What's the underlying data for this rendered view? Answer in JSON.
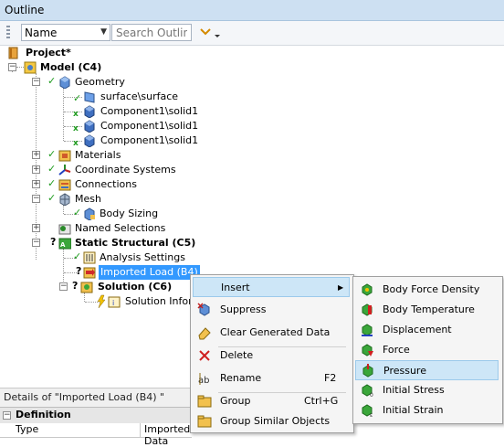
{
  "window": {
    "title": "Outline"
  },
  "toolbar": {
    "filter_value": "Name",
    "search_placeholder": "Search Outline"
  },
  "tree": {
    "project": "Project*",
    "model": "Model (C4)",
    "geometry": "Geometry",
    "geometry_children": [
      "surface\\surface",
      "Component1\\solid1",
      "Component1\\solid1",
      "Component1\\solid1"
    ],
    "materials": "Materials",
    "coordinate_systems": "Coordinate Systems",
    "connections": "Connections",
    "mesh": "Mesh",
    "body_sizing": "Body Sizing",
    "named_selections": "Named Selections",
    "static_structural": "Static Structural (C5)",
    "analysis_settings": "Analysis Settings",
    "imported_load": "Imported Load (B4)",
    "solution": "Solution (C6)",
    "solution_information": "Solution Inform",
    "check_mark": "✓",
    "question_mark": "?"
  },
  "details": {
    "title": "Details of \"Imported Load (B4) \"",
    "group": "Definition",
    "row_key": "Type",
    "row_value": "Imported Data"
  },
  "context_menu": {
    "items": [
      {
        "label": "Insert",
        "shortcut": "",
        "icon": "none"
      },
      {
        "label": "Suppress",
        "shortcut": "",
        "icon": "suppress-icon"
      },
      {
        "label": "Clear Generated Data",
        "shortcut": "",
        "icon": "eraser-icon"
      },
      {
        "label": "Delete",
        "shortcut": "",
        "icon": "delete-x-icon"
      },
      {
        "label": "Rename",
        "shortcut": "F2",
        "icon": "rename-icon"
      },
      {
        "label": "Group",
        "shortcut": "Ctrl+G",
        "icon": "folder-icon"
      },
      {
        "label": "Group Similar Objects",
        "shortcut": "",
        "icon": "folder-icon"
      }
    ],
    "submenu_arrow": "▶"
  },
  "insert_submenu": {
    "items": [
      {
        "label": "Body Force Density",
        "icon": "body-force-density-icon"
      },
      {
        "label": "Body Temperature",
        "icon": "body-temperature-icon"
      },
      {
        "label": "Displacement",
        "icon": "displacement-icon"
      },
      {
        "label": "Force",
        "icon": "force-icon"
      },
      {
        "label": "Pressure",
        "icon": "pressure-icon"
      },
      {
        "label": "Initial Stress",
        "icon": "initial-stress-icon"
      },
      {
        "label": "Initial Strain",
        "icon": "initial-strain-icon"
      }
    ],
    "highlighted": "Pressure"
  },
  "colors": {
    "selection": "#3399ff",
    "menu_highlight": "#cde6f7",
    "titlebar": "#cde0f2",
    "check": "#1d9b1d"
  }
}
